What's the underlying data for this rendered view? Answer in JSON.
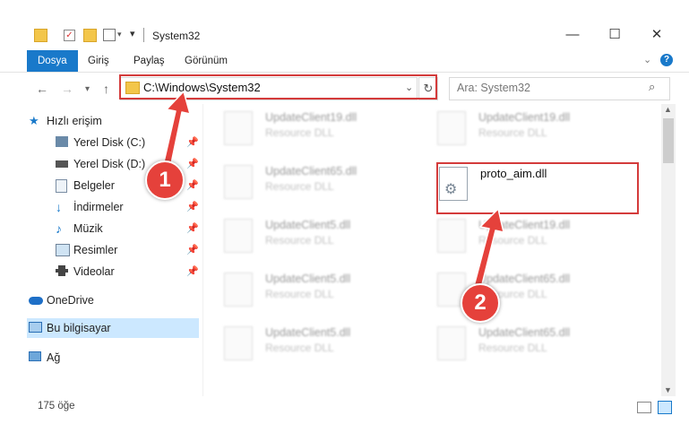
{
  "window": {
    "title": "System32",
    "minimize": "—",
    "maximize": "☐",
    "close": "✕"
  },
  "ribbon": {
    "tabs": [
      "Dosya",
      "Giriş",
      "Paylaş",
      "Görünüm"
    ]
  },
  "address": {
    "path": "C:\\Windows\\System32",
    "search_placeholder": "Ara: System32"
  },
  "sidebar": {
    "items": [
      {
        "label": "Hızlı erişim"
      },
      {
        "label": "Yerel Disk (C:)"
      },
      {
        "label": "Yerel Disk (D:)"
      },
      {
        "label": "Belgeler"
      },
      {
        "label": "İndirmeler"
      },
      {
        "label": "Müzik"
      },
      {
        "label": "Resimler"
      },
      {
        "label": "Videolar"
      },
      {
        "label": "OneDrive"
      },
      {
        "label": "Bu bilgisayar"
      },
      {
        "label": "Ağ"
      }
    ]
  },
  "files": [
    {
      "name": "UpdateClient19.dll",
      "type": "Resource DLL"
    },
    {
      "name": "UpdateClient19.dll",
      "type": "Resource DLL"
    },
    {
      "name": "UpdateClient65.dll",
      "type": "Resource DLL"
    },
    {
      "name": "proto_aim.dll",
      "type": ""
    },
    {
      "name": "UpdateClient5.dll",
      "type": "Resource DLL"
    },
    {
      "name": "UpdateClient19.dll",
      "type": "Resource DLL"
    },
    {
      "name": "UpdateClient5.dll",
      "type": "Resource DLL"
    },
    {
      "name": "UpdateClient65.dll",
      "type": "Resource DLL"
    },
    {
      "name": "UpdateClient5.dll",
      "type": "Resource DLL"
    },
    {
      "name": "UpdateClient65.dll",
      "type": "Resource DLL"
    }
  ],
  "status": {
    "count": "175 öğe"
  },
  "callouts": {
    "one": "1",
    "two": "2"
  },
  "colors": {
    "accent": "#1979ca",
    "highlight": "#d43b3b",
    "badge": "#e5413b",
    "selection": "#cce8ff"
  }
}
